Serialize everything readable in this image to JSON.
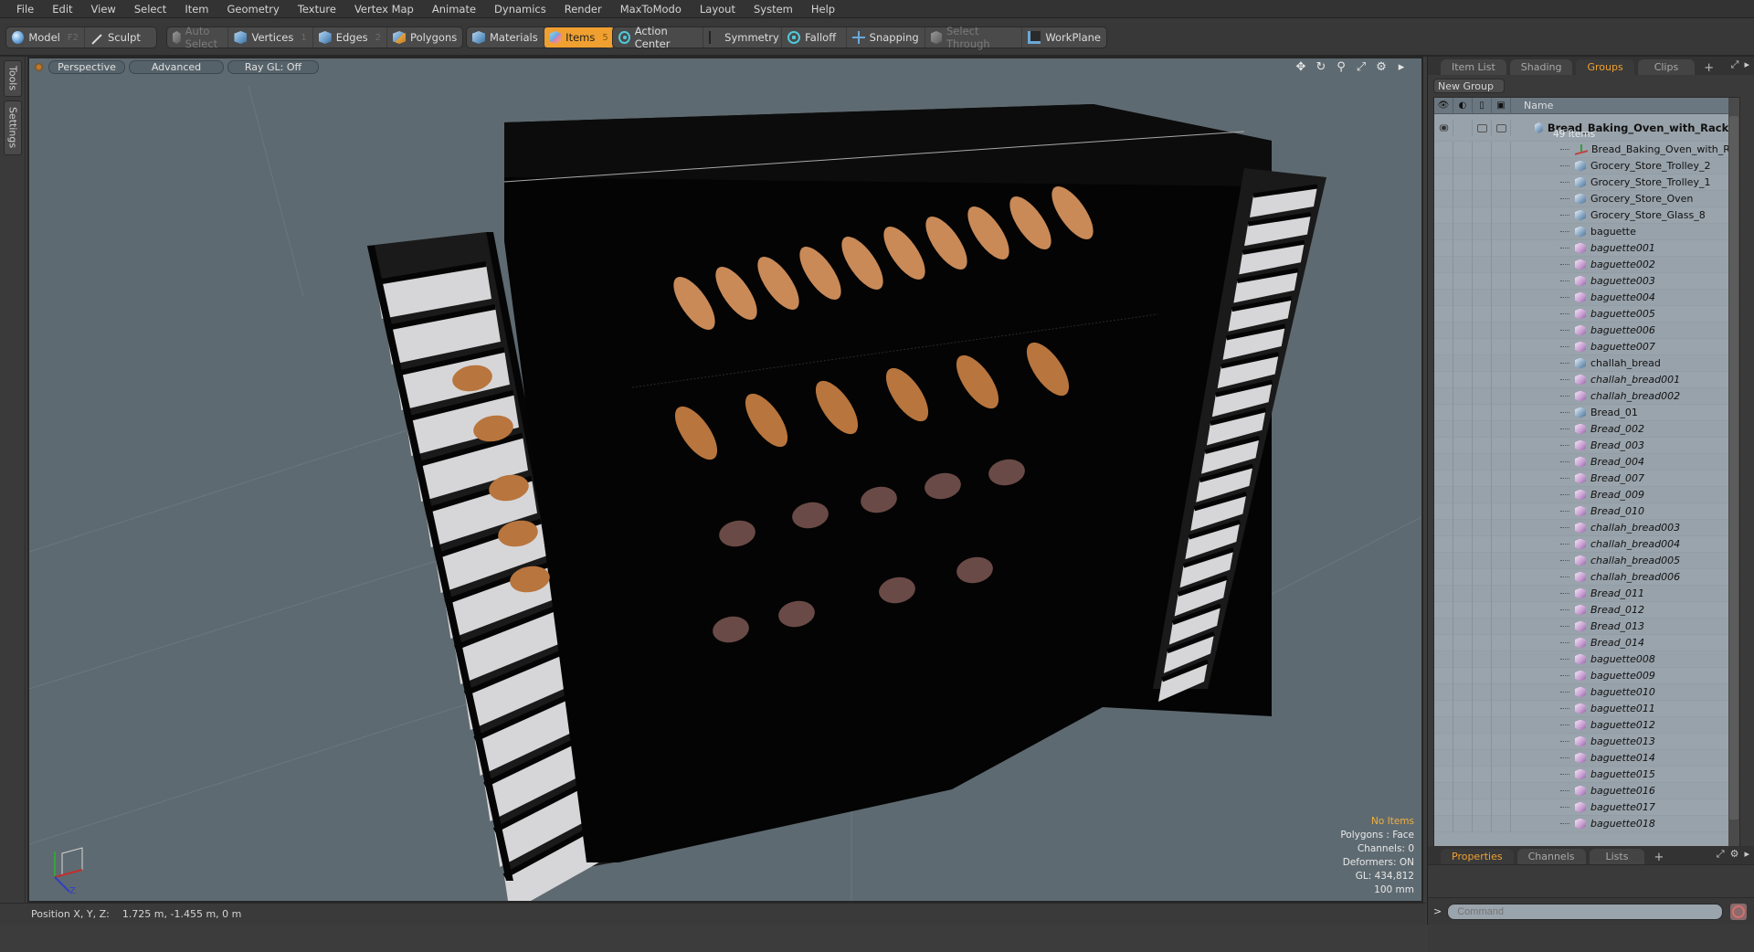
{
  "menubar": {
    "items": [
      "File",
      "Edit",
      "View",
      "Select",
      "Item",
      "Geometry",
      "Texture",
      "Vertex Map",
      "Animate",
      "Dynamics",
      "Render",
      "MaxToModo",
      "Layout",
      "System",
      "Help"
    ]
  },
  "toolbar": {
    "model": {
      "label": "Model",
      "hotkey": "F2",
      "icon": "sphere-icon"
    },
    "sculpt": {
      "label": "Sculpt",
      "icon": "brush-icon"
    },
    "auto_select": {
      "label": "Auto Select",
      "icon": "cube-icon",
      "state": "disabled"
    },
    "vertices": {
      "label": "Vertices",
      "hotkey": "1",
      "icon": "cube-icon"
    },
    "edges": {
      "label": "Edges",
      "hotkey": "2",
      "icon": "cube-icon"
    },
    "polygons": {
      "label": "Polygons",
      "icon": "cube-icon"
    },
    "materials": {
      "label": "Materials",
      "icon": "cube-icon"
    },
    "items": {
      "label": "Items",
      "hotkey": "5",
      "icon": "cube-icon",
      "state": "active"
    },
    "action_center": {
      "label": "Action Center",
      "icon": "target-icon"
    },
    "symmetry": {
      "label": "Symmetry",
      "icon": "symmetry-icon"
    },
    "falloff": {
      "label": "Falloff",
      "icon": "falloff-icon"
    },
    "snapping": {
      "label": "Snapping",
      "icon": "snap-icon"
    },
    "select_through": {
      "label": "Select Through",
      "icon": "select-through-icon",
      "state": "disabled"
    },
    "workplane": {
      "label": "WorkPlane",
      "icon": "workplane-icon"
    }
  },
  "left_strip": {
    "tabs": [
      "Tools",
      "Settings"
    ]
  },
  "viewport": {
    "view_mode": "Perspective",
    "shading": "Advanced",
    "ray_gl": "Ray GL: Off",
    "nav_icons": [
      "move-icon",
      "rotate-icon",
      "zoom-icon",
      "maximize-icon",
      "gear-icon",
      "play-icon"
    ],
    "info": {
      "selection": "No Items",
      "polygons": "Polygons : Face",
      "channels": "Channels: 0",
      "deformers": "Deformers: ON",
      "gl": "GL: 434,812",
      "grid_size": "100 mm"
    },
    "axis_labels": {
      "z": "Z"
    }
  },
  "statusbar": {
    "label": "Position X, Y, Z:",
    "value": "1.725 m, -1.455 m, 0 m"
  },
  "right_panel": {
    "tabs": [
      {
        "label": "Item List",
        "active": false
      },
      {
        "label": "Shading",
        "active": false
      },
      {
        "label": "Groups",
        "active": true
      },
      {
        "label": "Clips",
        "active": false
      }
    ],
    "new_group_label": "New Group",
    "list_header": {
      "name": "Name"
    },
    "group": {
      "name": "Bread_Baking_Oven_with_Racks",
      "suffix": "( ...",
      "count": "49 Items"
    },
    "items": [
      {
        "name": "Bread_Baking_Oven_with_Racks",
        "type": "locator"
      },
      {
        "name": "Grocery_Store_Trolley_2",
        "type": "mesh"
      },
      {
        "name": "Grocery_Store_Trolley_1",
        "type": "mesh"
      },
      {
        "name": "Grocery_Store_Oven",
        "type": "mesh"
      },
      {
        "name": "Grocery_Store_Glass_8",
        "type": "mesh"
      },
      {
        "name": "baguette",
        "type": "mesh"
      },
      {
        "name": "baguette001",
        "type": "instance"
      },
      {
        "name": "baguette002",
        "type": "instance"
      },
      {
        "name": "baguette003",
        "type": "instance"
      },
      {
        "name": "baguette004",
        "type": "instance"
      },
      {
        "name": "baguette005",
        "type": "instance"
      },
      {
        "name": "baguette006",
        "type": "instance"
      },
      {
        "name": "baguette007",
        "type": "instance"
      },
      {
        "name": "challah_bread",
        "type": "mesh"
      },
      {
        "name": "challah_bread001",
        "type": "instance"
      },
      {
        "name": "challah_bread002",
        "type": "instance"
      },
      {
        "name": "Bread_01",
        "type": "mesh"
      },
      {
        "name": "Bread_002",
        "type": "instance"
      },
      {
        "name": "Bread_003",
        "type": "instance"
      },
      {
        "name": "Bread_004",
        "type": "instance"
      },
      {
        "name": "Bread_007",
        "type": "instance"
      },
      {
        "name": "Bread_009",
        "type": "instance"
      },
      {
        "name": "Bread_010",
        "type": "instance"
      },
      {
        "name": "challah_bread003",
        "type": "instance"
      },
      {
        "name": "challah_bread004",
        "type": "instance"
      },
      {
        "name": "challah_bread005",
        "type": "instance"
      },
      {
        "name": "challah_bread006",
        "type": "instance"
      },
      {
        "name": "Bread_011",
        "type": "instance"
      },
      {
        "name": "Bread_012",
        "type": "instance"
      },
      {
        "name": "Bread_013",
        "type": "instance"
      },
      {
        "name": "Bread_014",
        "type": "instance"
      },
      {
        "name": "baguette008",
        "type": "instance"
      },
      {
        "name": "baguette009",
        "type": "instance"
      },
      {
        "name": "baguette010",
        "type": "instance"
      },
      {
        "name": "baguette011",
        "type": "instance"
      },
      {
        "name": "baguette012",
        "type": "instance"
      },
      {
        "name": "baguette013",
        "type": "instance"
      },
      {
        "name": "baguette014",
        "type": "instance"
      },
      {
        "name": "baguette015",
        "type": "instance"
      },
      {
        "name": "baguette016",
        "type": "instance"
      },
      {
        "name": "baguette017",
        "type": "instance"
      },
      {
        "name": "baguette018",
        "type": "instance"
      }
    ],
    "bottom_tabs": [
      {
        "label": "Properties",
        "active": true
      },
      {
        "label": "Channels",
        "active": false
      },
      {
        "label": "Lists",
        "active": false
      }
    ],
    "command_placeholder": "Command",
    "command_prompt": ">"
  },
  "colors": {
    "accent": "#f0a030",
    "viewport_bg": "#5e6a71",
    "list_bg": "#98a2aa",
    "instance_icon": "#c59ad0",
    "mesh_icon": "#7fa0bf"
  }
}
